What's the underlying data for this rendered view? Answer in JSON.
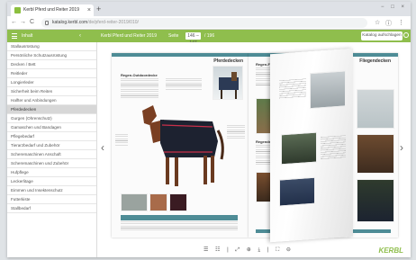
{
  "browser": {
    "tab_title": "Kerbl Pferd und Reiter 2019",
    "url_host": "katalog.kerbl.com",
    "url_rest": "/de/pferd-reiter-2019/010/",
    "back": "←",
    "forward": "→",
    "reload": "C",
    "info": "ⓘ",
    "star": "☆",
    "menu": "⋮",
    "window_controls": "− □ ×"
  },
  "appbar": {
    "category_label": "Inhalt",
    "separator": "‹",
    "catalog_title": "Kerbl Pferd und Reiter 2019",
    "page_label": "Seite",
    "page_value": "146 – 147",
    "page_total": "/ 196",
    "button_label": "Katalog aufschlagen"
  },
  "sidebar": {
    "items": [
      {
        "label": "Stallausrüstung",
        "active": false
      },
      {
        "label": "Persönliche Schutzausrüstung",
        "active": false
      },
      {
        "label": "Decken / Bett",
        "active": false
      },
      {
        "label": "Reitleder",
        "active": false
      },
      {
        "label": "Longierleder",
        "active": false
      },
      {
        "label": "Sicherheit beim Reiten",
        "active": false
      },
      {
        "label": "Halfter und Anbindungen",
        "active": false
      },
      {
        "label": "Pferdedecken",
        "active": true
      },
      {
        "label": "Gurgen (Ohrenschutz)",
        "active": false
      },
      {
        "label": "Gamaschen und Bandagen",
        "active": false
      },
      {
        "label": "Pflegebedarf",
        "active": false
      },
      {
        "label": "Tierarzbedarf und Zubehör",
        "active": false
      },
      {
        "label": "Scheremaschinen Anschaft",
        "active": false
      },
      {
        "label": "Scheremaschinen und Zubehör",
        "active": false
      },
      {
        "label": "Hufpflege",
        "active": false
      },
      {
        "label": "Leckerlitage",
        "active": false
      },
      {
        "label": "Eimmen und Insektenschutz",
        "active": false
      },
      {
        "label": "Futterkiste",
        "active": false
      },
      {
        "label": "Stallbedarf",
        "active": false
      }
    ]
  },
  "viewer": {
    "left_arrow": "‹",
    "right_arrow": "›",
    "left_page_header": "Pferdedecken",
    "right_page_header": "Fliegendecken",
    "product_1": "Regen-Outdoordecke",
    "product_2": "Regen-Fliegendecke",
    "product_3": "Regendecke",
    "toolbar_icons": "☰ ☷ | ⤢ ⊕ ⤓ | ⛶ ⊖",
    "brand": "KERBL"
  },
  "colors": {
    "accent": "#8fbe4d",
    "teal": "#4e8c96"
  }
}
